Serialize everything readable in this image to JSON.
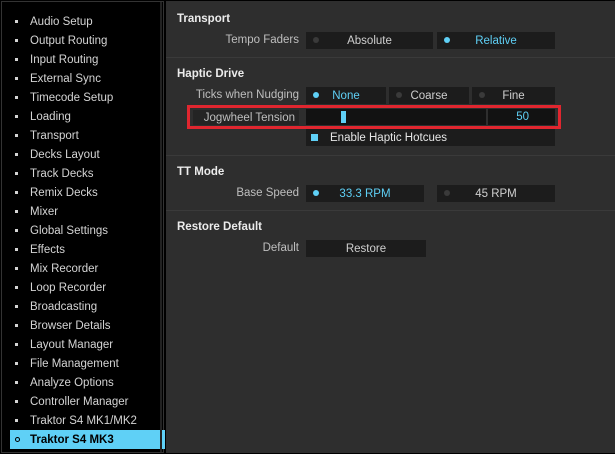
{
  "sidebar": {
    "items": [
      {
        "label": "Audio Setup"
      },
      {
        "label": "Output Routing"
      },
      {
        "label": "Input Routing"
      },
      {
        "label": "External Sync"
      },
      {
        "label": "Timecode Setup"
      },
      {
        "label": "Loading"
      },
      {
        "label": "Transport"
      },
      {
        "label": "Decks Layout"
      },
      {
        "label": "Track Decks"
      },
      {
        "label": "Remix Decks"
      },
      {
        "label": "Mixer"
      },
      {
        "label": "Global Settings"
      },
      {
        "label": "Effects"
      },
      {
        "label": "Mix Recorder"
      },
      {
        "label": "Loop Recorder"
      },
      {
        "label": "Broadcasting"
      },
      {
        "label": "Browser Details"
      },
      {
        "label": "Layout Manager"
      },
      {
        "label": "File Management"
      },
      {
        "label": "Analyze Options"
      },
      {
        "label": "Controller Manager"
      },
      {
        "label": "Traktor S4 MK1/MK2"
      },
      {
        "label": "Traktor S4 MK3"
      }
    ],
    "active_index": 22
  },
  "transport": {
    "title": "Transport",
    "tempo_faders_label": "Tempo Faders",
    "absolute_label": "Absolute",
    "relative_label": "Relative",
    "selected": "relative"
  },
  "haptic_drive": {
    "title": "Haptic Drive",
    "ticks_label": "Ticks when Nudging",
    "none_label": "None",
    "coarse_label": "Coarse",
    "fine_label": "Fine",
    "selected": "none",
    "tension_label": "Jogwheel Tension",
    "tension_value": "50",
    "tension_fraction": 0.2,
    "haptic_hotcues_label": "Enable Haptic Hotcues",
    "haptic_hotcues_checked": true
  },
  "tt_mode": {
    "title": "TT Mode",
    "base_speed_label": "Base Speed",
    "rpm33_label": "33.3 RPM",
    "rpm45_label": "45 RPM",
    "selected": "33"
  },
  "restore_default": {
    "title": "Restore Default",
    "default_label": "Default",
    "restore_label": "Restore"
  },
  "colors": {
    "accent": "#5fd0f6",
    "highlight": "#e0262f",
    "panel": "#2e2e2e"
  }
}
